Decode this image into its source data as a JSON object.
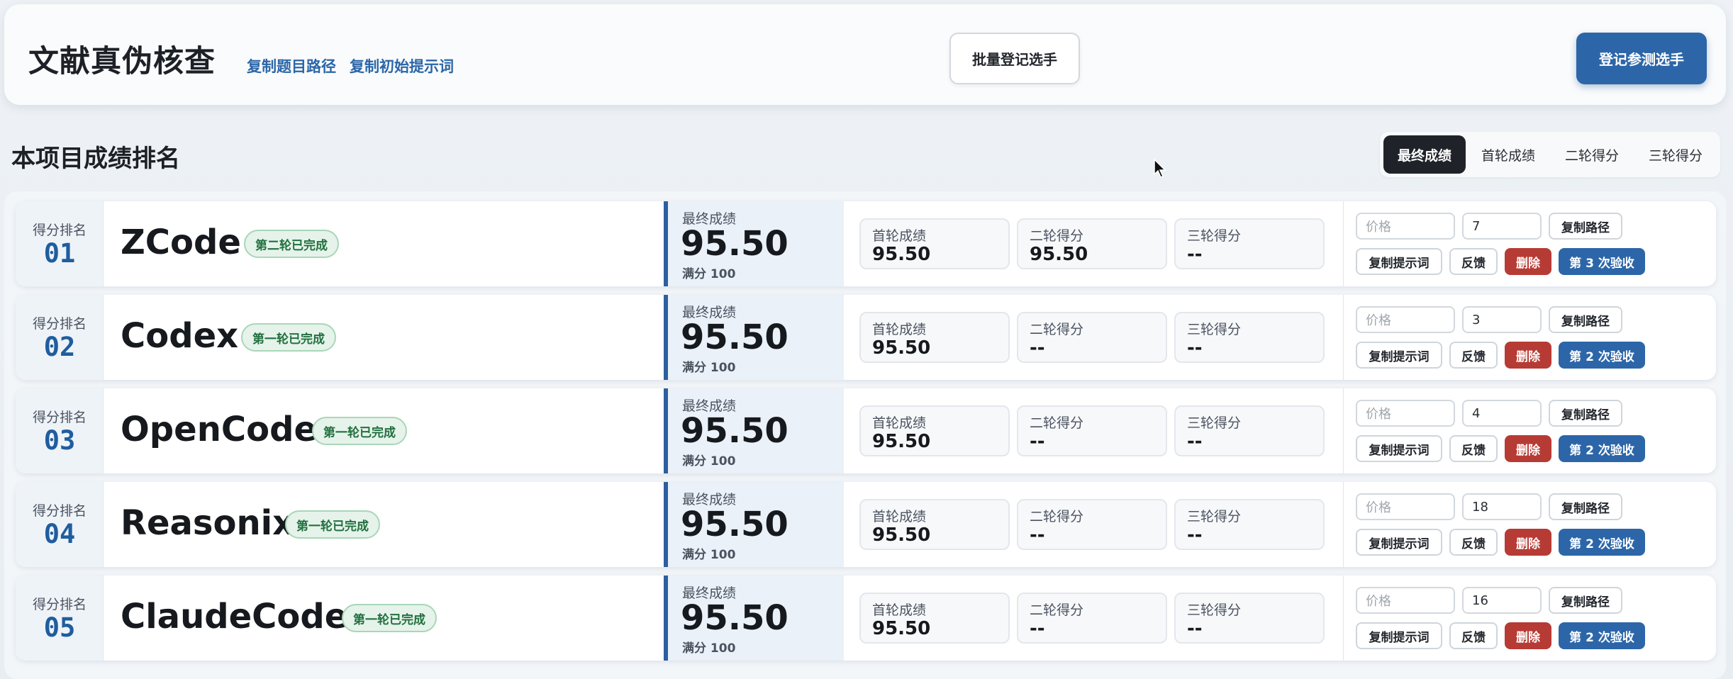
{
  "header": {
    "title": "文献真伪核查",
    "link_copy_path": "复制题目路径",
    "link_copy_prompt": "复制初始提示词",
    "batch_button": "批量登记选手",
    "register_button": "登记参测选手"
  },
  "section": {
    "title": "本项目成绩排名",
    "tabs": [
      "最终成绩",
      "首轮成绩",
      "二轮得分",
      "三轮得分"
    ],
    "active_tab": "最终成绩"
  },
  "labels": {
    "rank": "得分排名",
    "final": "最终成绩",
    "full_score": "满分 100",
    "round1": "首轮成绩",
    "round2": "二轮得分",
    "round3": "三轮得分",
    "price_placeholder": "价格",
    "copy_path": "复制路径",
    "copy_prompt": "复制提示词",
    "feedback": "反馈",
    "delete": "删除"
  },
  "rows": [
    {
      "rank": "01",
      "name": "ZCode",
      "status": "第二轮已完成",
      "final": "95.50",
      "round1": "95.50",
      "round2": "95.50",
      "round3": "--",
      "count": "7",
      "accept": "第 3 次验收"
    },
    {
      "rank": "02",
      "name": "Codex",
      "status": "第一轮已完成",
      "final": "95.50",
      "round1": "95.50",
      "round2": "--",
      "round3": "--",
      "count": "3",
      "accept": "第 2 次验收"
    },
    {
      "rank": "03",
      "name": "OpenCode",
      "status": "第一轮已完成",
      "final": "95.50",
      "round1": "95.50",
      "round2": "--",
      "round3": "--",
      "count": "4",
      "accept": "第 2 次验收"
    },
    {
      "rank": "04",
      "name": "Reasonix",
      "status": "第一轮已完成",
      "final": "95.50",
      "round1": "95.50",
      "round2": "--",
      "round3": "--",
      "count": "18",
      "accept": "第 2 次验收"
    },
    {
      "rank": "05",
      "name": "ClaudeCode",
      "status": "第一轮已完成",
      "final": "95.50",
      "round1": "95.50",
      "round2": "--",
      "round3": "--",
      "count": "16",
      "accept": "第 2 次验收"
    }
  ],
  "colors": {
    "accent": "#2c66a8",
    "danger": "#b73b35",
    "badge_bg": "#e5f3ea",
    "badge_text": "#22703f"
  }
}
